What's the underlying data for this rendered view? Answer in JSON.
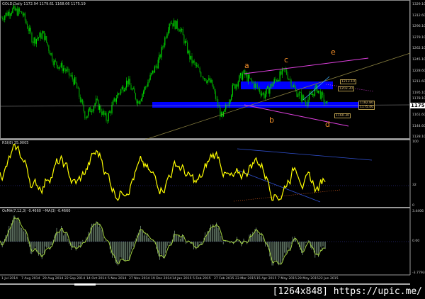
{
  "header": {
    "symbol": "GOLD,Daily",
    "ohlc": "1172.94 1179.61 1168.06 1175.19"
  },
  "rsi": {
    "label": "RSI(8) 35.9005",
    "axis": [
      "100",
      "32",
      "0"
    ],
    "level": 32
  },
  "macd": {
    "label": "OsMA(7,12,3) -0.4660  ~MA(3) -0.4660",
    "axis": [
      "3.4406",
      "0.00",
      "-3.7793"
    ]
  },
  "price_axis": [
    "1329.10",
    "1312.60",
    "1296.10",
    "1279.10",
    "1262.10",
    "1245.10",
    "1228.60",
    "1211.60",
    "1195.10",
    "1178.10",
    "1161.60",
    "1144.60",
    "1128.10"
  ],
  "current_price": "1175.19",
  "date_axis": [
    "1 Jul 2014",
    "7 Aug 2014",
    "29 Aug 2014",
    "22 Sep 2014",
    "14 Oct 2014",
    "5 Nov 2014",
    "27 Nov 2014",
    "19 Dec 2014",
    "14 Jan 2015",
    "5 Feb 2015",
    "27 Feb 2015",
    "23 Mar 2015",
    "15 Apr 2015",
    "7 May 2015",
    "29 May 2015",
    "22 Jun 2015"
  ],
  "wave_labels": [
    "a",
    "b",
    "c",
    "d",
    "e"
  ],
  "price_tags": [
    "1213.10",
    "1203.30",
    "1182.80",
    "1175.40",
    "1160.30"
  ],
  "watermark": "[1264x848] https://upic.me/",
  "colors": {
    "bull": "#00e000",
    "bear": "#00a000",
    "rsi": "#ffff00",
    "zone": "#0000ff",
    "wave": "#f08c28",
    "channel": "#e040e0"
  },
  "chart_data": {
    "type": "candlestick",
    "symbol": "GOLD",
    "timeframe": "Daily",
    "price_path": [
      1310,
      1322,
      1316,
      1275,
      1285,
      1242,
      1232,
      1212,
      1160,
      1182,
      1155,
      1192,
      1214,
      1182,
      1214,
      1246,
      1305,
      1294,
      1246,
      1225,
      1209,
      1155,
      1203,
      1225,
      1209,
      1192,
      1214,
      1230,
      1198,
      1182,
      1203,
      1175
    ],
    "ylim": [
      1128.1,
      1329.1
    ]
  }
}
